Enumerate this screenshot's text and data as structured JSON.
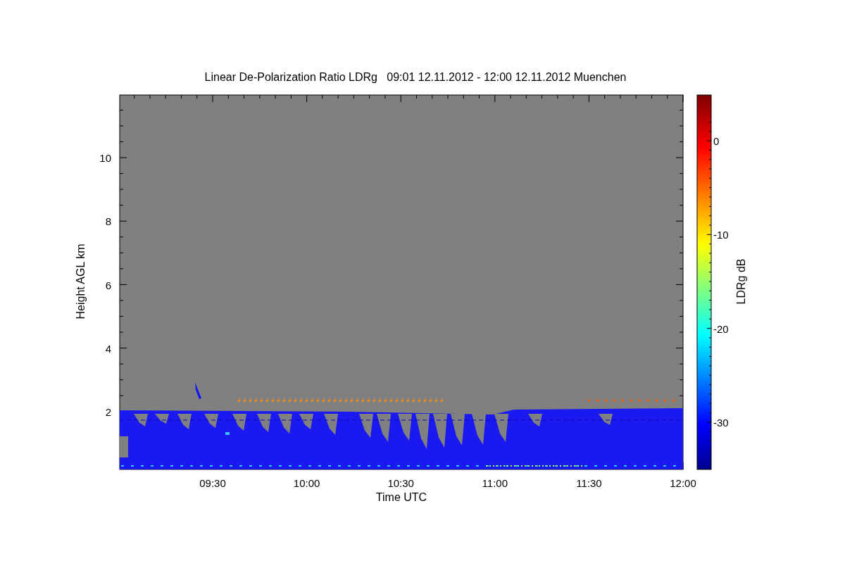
{
  "title": "Linear De-Polarization Ratio LDRg   09:01 12.11.2012 - 12:00 12.11.2012 Muenchen",
  "y_axis": {
    "label": "Height AGL km",
    "ticks": [
      "10",
      "8",
      "6",
      "4",
      "2"
    ]
  },
  "x_axis": {
    "label": "Time UTC",
    "ticks": [
      "09:30",
      "10:00",
      "10:30",
      "11:00",
      "11:30",
      "12:00"
    ]
  },
  "colorbar": {
    "label": "LDRg dB",
    "ticks": [
      "0",
      "-10",
      "-20",
      "-30"
    ]
  }
}
